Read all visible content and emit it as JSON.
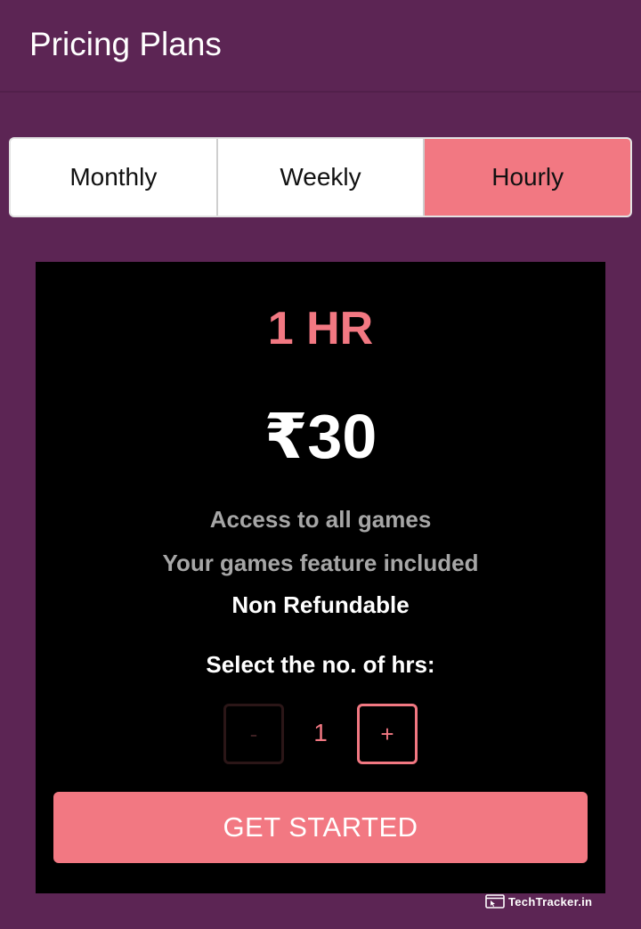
{
  "appbar": {
    "title": "Pricing Plans"
  },
  "tabs": [
    {
      "label": "Monthly",
      "active": false
    },
    {
      "label": "Weekly",
      "active": false
    },
    {
      "label": "Hourly",
      "active": true
    }
  ],
  "plan": {
    "name": "1 HR",
    "price": "₹30",
    "features": [
      "Access to all games",
      "Your games feature included",
      "Non Refundable"
    ],
    "select_label": "Select the no. of hrs:",
    "stepper": {
      "minus_label": "-",
      "value": "1",
      "plus_label": "+"
    },
    "cta_label": "GET STARTED"
  },
  "watermark": {
    "text": "TechTracker.in",
    "icon": "browser-window-cursor-icon"
  },
  "colors": {
    "background": "#5c2554",
    "accent": "#f27882",
    "card": "#000000"
  }
}
